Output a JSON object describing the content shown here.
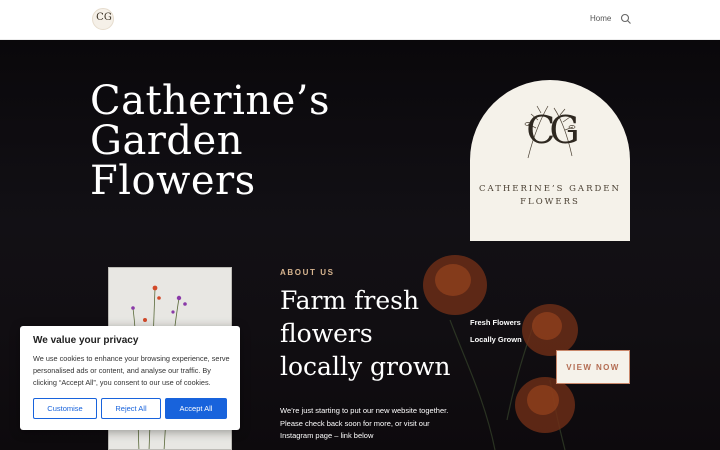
{
  "header": {
    "logo_text": "CG",
    "nav_home": "Home"
  },
  "hero": {
    "title_line1": "Catherine’s Garden",
    "title_line2": "Flowers"
  },
  "badge": {
    "monogram": "CG",
    "name_line1": "CATHERINE’S GARDEN",
    "name_line2": "FLOWERS"
  },
  "about": {
    "label": "ABOUT US",
    "heading_line1": "Farm fresh",
    "heading_line2": "flowers",
    "heading_line3": "locally grown",
    "text": "We’re just starting to put our new website together. Please check back soon for more, or visit our Instagram page – link below"
  },
  "features": [
    "Fresh Flowers",
    "Locally Grown"
  ],
  "view_now": "VIEW NOW",
  "cookie": {
    "title": "We value your privacy",
    "text": "We use cookies to enhance your browsing experience, serve personalised ads or content, and analyse our traffic. By clicking “Accept All”, you consent to our use of cookies.",
    "customise": "Customise",
    "reject": "Reject All",
    "accept": "Accept All"
  },
  "colors": {
    "accent_gold": "#d8b590",
    "button_terracotta": "#b36c52",
    "cookie_blue": "#1863dc",
    "cream": "#f5f2ea"
  },
  "icons": {
    "search": "search-icon"
  }
}
